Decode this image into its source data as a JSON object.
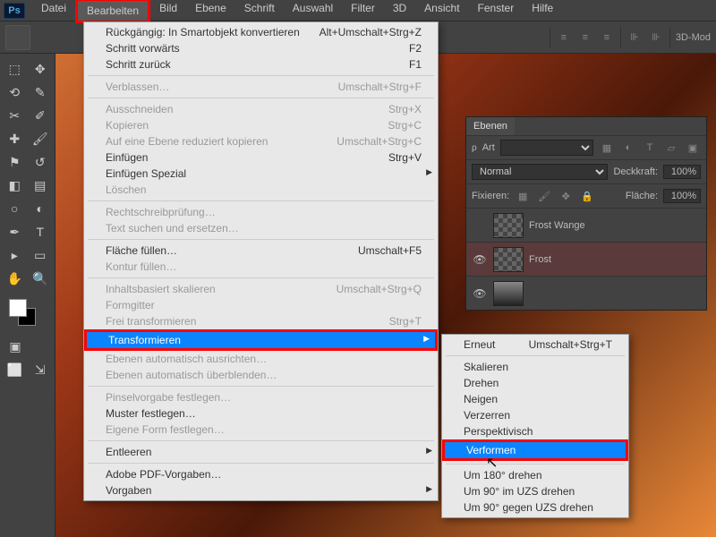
{
  "app": {
    "logo": "Ps"
  },
  "menubar": [
    "Datei",
    "Bearbeiten",
    "Bild",
    "Ebene",
    "Schrift",
    "Auswahl",
    "Filter",
    "3D",
    "Ansicht",
    "Fenster",
    "Hilfe"
  ],
  "activeMenu": "Bearbeiten",
  "optionsbar": {
    "mode_label": "3D-Mod"
  },
  "editMenu": [
    {
      "label": "Rückgängig: In Smartobjekt konvertieren",
      "shortcut": "Alt+Umschalt+Strg+Z",
      "disabled": false
    },
    {
      "label": "Schritt vorwärts",
      "shortcut": "F2",
      "disabled": false
    },
    {
      "label": "Schritt zurück",
      "shortcut": "F1",
      "disabled": false
    },
    {
      "sep": true
    },
    {
      "label": "Verblassen…",
      "shortcut": "Umschalt+Strg+F",
      "disabled": true
    },
    {
      "sep": true
    },
    {
      "label": "Ausschneiden",
      "shortcut": "Strg+X",
      "disabled": true
    },
    {
      "label": "Kopieren",
      "shortcut": "Strg+C",
      "disabled": true
    },
    {
      "label": "Auf eine Ebene reduziert kopieren",
      "shortcut": "Umschalt+Strg+C",
      "disabled": true
    },
    {
      "label": "Einfügen",
      "shortcut": "Strg+V",
      "disabled": false
    },
    {
      "label": "Einfügen Spezial",
      "shortcut": "",
      "disabled": false,
      "arrow": true
    },
    {
      "label": "Löschen",
      "shortcut": "",
      "disabled": true
    },
    {
      "sep": true
    },
    {
      "label": "Rechtschreibprüfung…",
      "shortcut": "",
      "disabled": true
    },
    {
      "label": "Text suchen und ersetzen…",
      "shortcut": "",
      "disabled": true
    },
    {
      "sep": true
    },
    {
      "label": "Fläche füllen…",
      "shortcut": "Umschalt+F5",
      "disabled": false
    },
    {
      "label": "Kontur füllen…",
      "shortcut": "",
      "disabled": true
    },
    {
      "sep": true
    },
    {
      "label": "Inhaltsbasiert skalieren",
      "shortcut": "Umschalt+Strg+Q",
      "disabled": true
    },
    {
      "label": "Formgitter",
      "shortcut": "",
      "disabled": true
    },
    {
      "label": "Frei transformieren",
      "shortcut": "Strg+T",
      "disabled": true
    },
    {
      "label": "Transformieren",
      "shortcut": "",
      "disabled": false,
      "arrow": true,
      "highlight": true,
      "redbox": true
    },
    {
      "label": "Ebenen automatisch ausrichten…",
      "shortcut": "",
      "disabled": true
    },
    {
      "label": "Ebenen automatisch überblenden…",
      "shortcut": "",
      "disabled": true
    },
    {
      "sep": true
    },
    {
      "label": "Pinselvorgabe festlegen…",
      "shortcut": "",
      "disabled": true
    },
    {
      "label": "Muster festlegen…",
      "shortcut": "",
      "disabled": false
    },
    {
      "label": "Eigene Form festlegen…",
      "shortcut": "",
      "disabled": true
    },
    {
      "sep": true
    },
    {
      "label": "Entleeren",
      "shortcut": "",
      "disabled": false,
      "arrow": true
    },
    {
      "sep": true
    },
    {
      "label": "Adobe PDF-Vorgaben…",
      "shortcut": "",
      "disabled": false
    },
    {
      "label": "Vorgaben",
      "shortcut": "",
      "disabled": false,
      "arrow": true
    }
  ],
  "transformSubmenu": [
    {
      "label": "Erneut",
      "shortcut": "Umschalt+Strg+T"
    },
    {
      "sep": true
    },
    {
      "label": "Skalieren"
    },
    {
      "label": "Drehen"
    },
    {
      "label": "Neigen"
    },
    {
      "label": "Verzerren"
    },
    {
      "label": "Perspektivisch"
    },
    {
      "label": "Verformen",
      "highlight": true,
      "redbox": true
    },
    {
      "sep": true
    },
    {
      "label": "Um 180° drehen"
    },
    {
      "label": "Um 90° im UZS drehen"
    },
    {
      "label": "Um 90° gegen UZS drehen"
    }
  ],
  "layersPanel": {
    "tab": "Ebenen",
    "kind_label": "Art",
    "blend": "Normal",
    "opacity_label": "Deckkraft:",
    "opacity_value": "100%",
    "lock_label": "Fixieren:",
    "fill_label": "Fläche:",
    "fill_value": "100%",
    "layers": [
      {
        "name": "Frost Wange",
        "visible": false,
        "thumb": "checker",
        "selected": false
      },
      {
        "name": "Frost",
        "visible": true,
        "thumb": "checker",
        "selected": true
      },
      {
        "name": "",
        "visible": true,
        "thumb": "img",
        "selected": false
      }
    ]
  }
}
